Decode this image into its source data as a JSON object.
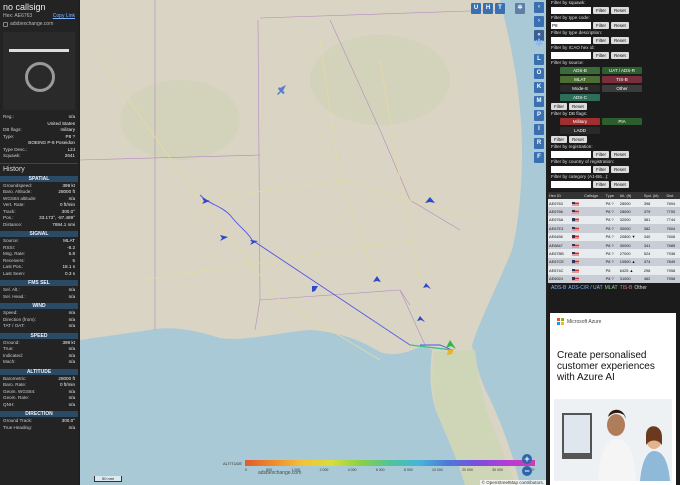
{
  "left_panel": {
    "callsign": "no callsign",
    "hex_label": "Hex: AE6763",
    "copy_link": "Copy Link",
    "source": "adsbexchange.com",
    "details": [
      {
        "k": "Reg.:",
        "v": "n/a"
      },
      {
        "k": "",
        "v": "United States"
      },
      {
        "k": "DB flags:",
        "v": "military"
      },
      {
        "k": "Type:",
        "v": "P8 ?"
      },
      {
        "k": "",
        "v": "BOEING P-8 Poseidon"
      },
      {
        "k": "Type Desc.:",
        "v": "L2J"
      },
      {
        "k": "Squawk:",
        "v": "2641"
      }
    ],
    "history_label": "History",
    "spatial_label": "SPATIAL",
    "spatial": [
      {
        "k": "Groundspeed:",
        "v": "398 kt"
      },
      {
        "k": "Baro. Altitude:",
        "v": "28000 ft"
      },
      {
        "k": "WGS84 altitude:",
        "v": "n/a"
      },
      {
        "k": "Vert. Rate:",
        "v": "0 ft/min"
      },
      {
        "k": "Track:",
        "v": "300.0°"
      },
      {
        "k": "Pos.:",
        "v": "33.173°, -87.489°"
      },
      {
        "k": "Distance:",
        "v": "7694.1 nmi"
      }
    ],
    "signal_label": "SIGNAL",
    "signal": [
      {
        "k": "Source:",
        "v": "MLAT"
      },
      {
        "k": "RSSI:",
        "v": "-8.2"
      },
      {
        "k": "Msg. Rate:",
        "v": "5.8"
      },
      {
        "k": "Receivers:",
        "v": "5"
      },
      {
        "k": "Last Pos.:",
        "v": "18.1 s"
      },
      {
        "k": "Last Seen:",
        "v": "0.3 s"
      }
    ],
    "fms_label": "FMS SEL",
    "fms": [
      {
        "k": "Sel. Alt.:",
        "v": "n/a"
      },
      {
        "k": "Sel. Head.:",
        "v": "n/a"
      }
    ],
    "wind_label": "WIND",
    "wind": [
      {
        "k": "Speed:",
        "v": "n/a"
      },
      {
        "k": "Direction (from):",
        "v": "n/a"
      },
      {
        "k": "TAT / OAT:",
        "v": "n/a"
      }
    ],
    "speed_label": "SPEED",
    "speed": [
      {
        "k": "Ground:",
        "v": "398 kt"
      },
      {
        "k": "True:",
        "v": "n/a"
      },
      {
        "k": "Indicated:",
        "v": "n/a"
      },
      {
        "k": "Mach:",
        "v": "n/a"
      }
    ],
    "altitude_label": "ALTITUDE",
    "altitude": [
      {
        "k": "Barometric:",
        "v": "28000 ft"
      },
      {
        "k": "Baro. Rate:",
        "v": "0 ft/min"
      },
      {
        "k": "Geom. WGS84:",
        "v": "n/a"
      },
      {
        "k": "Geom. Rate:",
        "v": "n/a"
      },
      {
        "k": "QNH:",
        "v": "n/a"
      }
    ],
    "direction_label": "DIRECTION",
    "direction": [
      {
        "k": "Ground Track:",
        "v": "300.0°"
      },
      {
        "k": "True Heading:",
        "v": "n/a"
      }
    ]
  },
  "map": {
    "top_buttons": [
      "U",
      "H",
      "T"
    ],
    "legend_title": "ALTITUDE",
    "legend_ticks": [
      "0",
      "500",
      "1 000",
      "2 000",
      "4 000",
      "6 000",
      "8 000",
      "10 000",
      "20 000",
      "30 000",
      "40 000+"
    ],
    "footer": "adsbexchange.com",
    "scale": "50 nmi",
    "attribution": "© OpenStreetMap contributors.",
    "colors": {
      "water": "#a9c9d6",
      "land": "#d9d4c3",
      "track": "#4c56e8",
      "aircraft": "#2f49c8"
    }
  },
  "side_buttons": [
    "L",
    "O",
    "K",
    "M",
    "P",
    "I",
    "R",
    "F"
  ],
  "filters": {
    "squawk_label": "Filter by squawk:",
    "type_label": "Filter by type code:",
    "type_value": "P8",
    "desc_label": "Filter by type description:",
    "icao_label": "Filter by ICAO hex id:",
    "source_label": "Filter by source:",
    "sources": [
      "ADS-B",
      "UAT / ADS-R",
      "MLAT",
      "TIS-B",
      "Mode-S",
      "Other",
      "ADS-C"
    ],
    "dbflags_label": "Filter by DB flags:",
    "dbflags": [
      "Military",
      "PIA",
      "LADD"
    ],
    "reg_label": "Filter by registration:",
    "country_label": "Filter by country of registration:",
    "category_label": "Filter by category (A1-B6...):",
    "filter_btn": "Filter",
    "reset_btn": "Reset"
  },
  "table": {
    "headers": [
      "Hex ID",
      "",
      "Callsign",
      "Type",
      "Alt. (ft)",
      "Spd. (kt)",
      "Dist."
    ],
    "rows": [
      [
        "AE6763",
        "",
        "P8 ?",
        "28000",
        "398",
        "7694"
      ],
      [
        "AE6766",
        "",
        "P8 ?",
        "28000",
        "379",
        "7700"
      ],
      [
        "AE676A",
        "",
        "P8 ?",
        "32000",
        "381",
        "7744"
      ],
      [
        "AE67E3",
        "",
        "P8 ?",
        "30000",
        "382",
        "7604"
      ],
      [
        "AE6456",
        "",
        "P8 ?",
        "20800 ▼",
        "340",
        "7606"
      ],
      [
        "AE6847",
        "",
        "P8 ?",
        "30000",
        "341",
        "7685"
      ],
      [
        "AE67BB",
        "",
        "P8 ?",
        "27000",
        "524",
        "7936"
      ],
      [
        "AE67CE",
        "",
        "P8 ?",
        "10500 ▲",
        "374",
        "7849"
      ],
      [
        "AE674C",
        "",
        "P8",
        "6425 ▲",
        "298",
        "7958"
      ],
      [
        "AE6924",
        "",
        "P8 ?",
        "31000",
        "462",
        "7958"
      ]
    ]
  },
  "tabs": [
    "ADS-B",
    "ADS-C/R / UAT",
    "MLAT",
    "TIS-B",
    "Other"
  ],
  "ad": {
    "brand": "Microsoft Azure",
    "headline": "Create personalised customer experiences with Azure AI"
  }
}
